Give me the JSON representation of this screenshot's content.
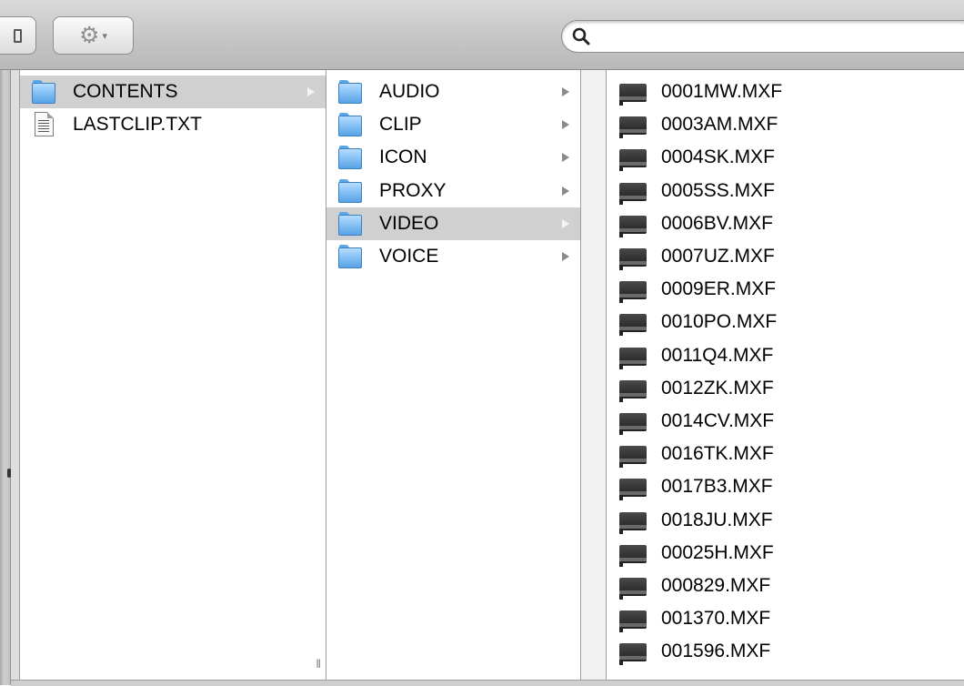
{
  "toolbar": {
    "view_button": "view-columns-icon",
    "action_button": "gear-icon",
    "action_caret": "▾",
    "search": {
      "placeholder": "",
      "value": "",
      "icon": "search-icon"
    }
  },
  "colors": {
    "selection": "#d0d0d0",
    "folder": "#7fbdf3",
    "toolbar": "#c4c4c4"
  },
  "columns": [
    {
      "items": [
        {
          "label": "CONTENTS",
          "icon": "folder-icon",
          "selected": true,
          "has_children": true
        },
        {
          "label": "LASTCLIP.TXT",
          "icon": "text-document-icon",
          "selected": false,
          "has_children": false
        }
      ]
    },
    {
      "items": [
        {
          "label": "AUDIO",
          "icon": "folder-icon",
          "selected": false,
          "has_children": true
        },
        {
          "label": "CLIP",
          "icon": "folder-icon",
          "selected": false,
          "has_children": true
        },
        {
          "label": "ICON",
          "icon": "folder-icon",
          "selected": false,
          "has_children": true
        },
        {
          "label": "PROXY",
          "icon": "folder-icon",
          "selected": false,
          "has_children": true
        },
        {
          "label": "VIDEO",
          "icon": "folder-icon",
          "selected": true,
          "has_children": true
        },
        {
          "label": "VOICE",
          "icon": "folder-icon",
          "selected": false,
          "has_children": true
        }
      ]
    },
    {
      "items": [
        {
          "label": "0001MW.MXF",
          "icon": "mxf-video-icon"
        },
        {
          "label": "0003AM.MXF",
          "icon": "mxf-video-icon"
        },
        {
          "label": "0004SK.MXF",
          "icon": "mxf-video-icon"
        },
        {
          "label": "0005SS.MXF",
          "icon": "mxf-video-icon"
        },
        {
          "label": "0006BV.MXF",
          "icon": "mxf-video-icon"
        },
        {
          "label": "0007UZ.MXF",
          "icon": "mxf-video-icon"
        },
        {
          "label": "0009ER.MXF",
          "icon": "mxf-video-icon"
        },
        {
          "label": "0010PO.MXF",
          "icon": "mxf-video-icon"
        },
        {
          "label": "0011Q4.MXF",
          "icon": "mxf-video-icon"
        },
        {
          "label": "0012ZK.MXF",
          "icon": "mxf-video-icon"
        },
        {
          "label": "0014CV.MXF",
          "icon": "mxf-video-icon"
        },
        {
          "label": "0016TK.MXF",
          "icon": "mxf-video-icon"
        },
        {
          "label": "0017B3.MXF",
          "icon": "mxf-video-icon"
        },
        {
          "label": "0018JU.MXF",
          "icon": "mxf-video-icon"
        },
        {
          "label": "00025H.MXF",
          "icon": "mxf-video-icon"
        },
        {
          "label": "000829.MXF",
          "icon": "mxf-video-icon"
        },
        {
          "label": "001370.MXF",
          "icon": "mxf-video-icon"
        },
        {
          "label": "001596.MXF",
          "icon": "mxf-video-icon"
        }
      ]
    }
  ]
}
